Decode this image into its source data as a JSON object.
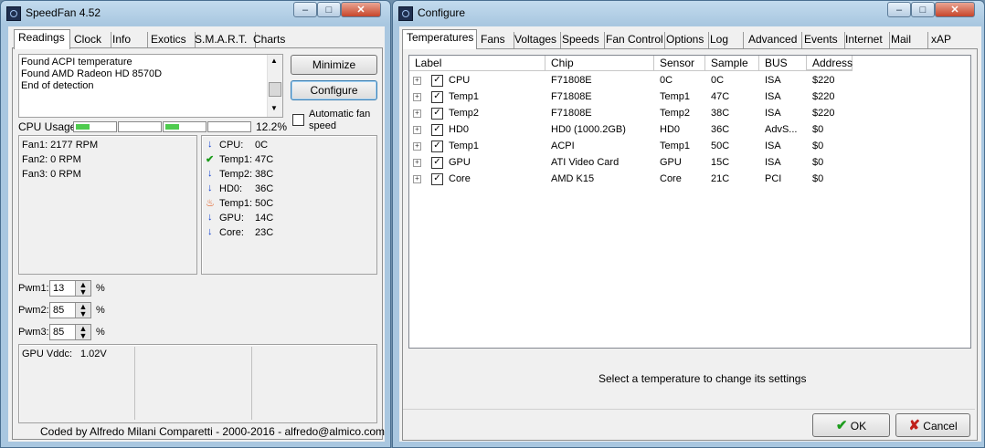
{
  "speedfan": {
    "title": "SpeedFan 4.52",
    "tabs": [
      "Readings",
      "Clock",
      "Info",
      "Exotics",
      "S.M.A.R.T.",
      "Charts"
    ],
    "log_lines": [
      "Found ACPI temperature",
      "Found AMD Radeon HD 8570D",
      "End of detection"
    ],
    "minimize_label": "Minimize",
    "configure_label": "Configure",
    "cpu_usage_label": "CPU Usage",
    "cpu_usage_value": "12.2%",
    "cpu_cores": [
      0.35,
      0,
      0.35,
      0
    ],
    "auto_fan_label": "Automatic fan speed",
    "fans": [
      "Fan1: 2177 RPM",
      "Fan2: 0 RPM",
      "Fan3: 0 RPM"
    ],
    "temps": [
      {
        "name": "CPU:",
        "value": "0C",
        "icon": "arrow-down-icon"
      },
      {
        "name": "Temp1:",
        "value": "47C",
        "icon": "check-icon"
      },
      {
        "name": "Temp2:",
        "value": "38C",
        "icon": "arrow-down-icon"
      },
      {
        "name": "HD0:",
        "value": "36C",
        "icon": "arrow-down-icon"
      },
      {
        "name": "Temp1:",
        "value": "50C",
        "icon": "flame-icon"
      },
      {
        "name": "GPU:",
        "value": "14C",
        "icon": "arrow-down-icon"
      },
      {
        "name": "Core:",
        "value": "23C",
        "icon": "arrow-down-icon"
      }
    ],
    "pwm": [
      {
        "label": "Pwm1:",
        "value": "13"
      },
      {
        "label": "Pwm2:",
        "value": "85"
      },
      {
        "label": "Pwm3:",
        "value": "85"
      }
    ],
    "pwm_unit": "%",
    "gpu_vddc_label": "GPU Vddc:",
    "gpu_vddc_value": "1.02V",
    "footer": "Coded by Alfredo Milani Comparetti - 2000-2016 - alfredo@almico.com"
  },
  "configure": {
    "title": "Configure",
    "tabs": [
      "Temperatures",
      "Fans",
      "Voltages",
      "Speeds",
      "Fan Control",
      "Options",
      "Log",
      "Advanced",
      "Events",
      "Internet",
      "Mail",
      "xAP"
    ],
    "columns": [
      "Label",
      "Chip",
      "Sensor",
      "Sample",
      "BUS",
      "Address"
    ],
    "rows": [
      {
        "label": "CPU",
        "chip": "F71808E",
        "sensor": "0C",
        "sample": "0C",
        "bus": "ISA",
        "address": "$220",
        "checked": true
      },
      {
        "label": "Temp1",
        "chip": "F71808E",
        "sensor": "Temp1",
        "sample": "47C",
        "bus": "ISA",
        "address": "$220",
        "checked": true
      },
      {
        "label": "Temp2",
        "chip": "F71808E",
        "sensor": "Temp2",
        "sample": "38C",
        "bus": "ISA",
        "address": "$220",
        "checked": true
      },
      {
        "label": "HD0",
        "chip": "HD0 (1000.2GB)",
        "sensor": "HD0",
        "sample": "36C",
        "bus": "AdvS...",
        "address": "$0",
        "checked": true
      },
      {
        "label": "Temp1",
        "chip": "ACPI",
        "sensor": "Temp1",
        "sample": "50C",
        "bus": "ISA",
        "address": "$0",
        "checked": true
      },
      {
        "label": "GPU",
        "chip": "ATI Video Card",
        "sensor": "GPU",
        "sample": "15C",
        "bus": "ISA",
        "address": "$0",
        "checked": true
      },
      {
        "label": "Core",
        "chip": "AMD K15",
        "sensor": "Core",
        "sample": "21C",
        "bus": "PCI",
        "address": "$0",
        "checked": true
      }
    ],
    "hint": "Select a temperature to change its settings",
    "ok_label": "OK",
    "cancel_label": "Cancel"
  }
}
